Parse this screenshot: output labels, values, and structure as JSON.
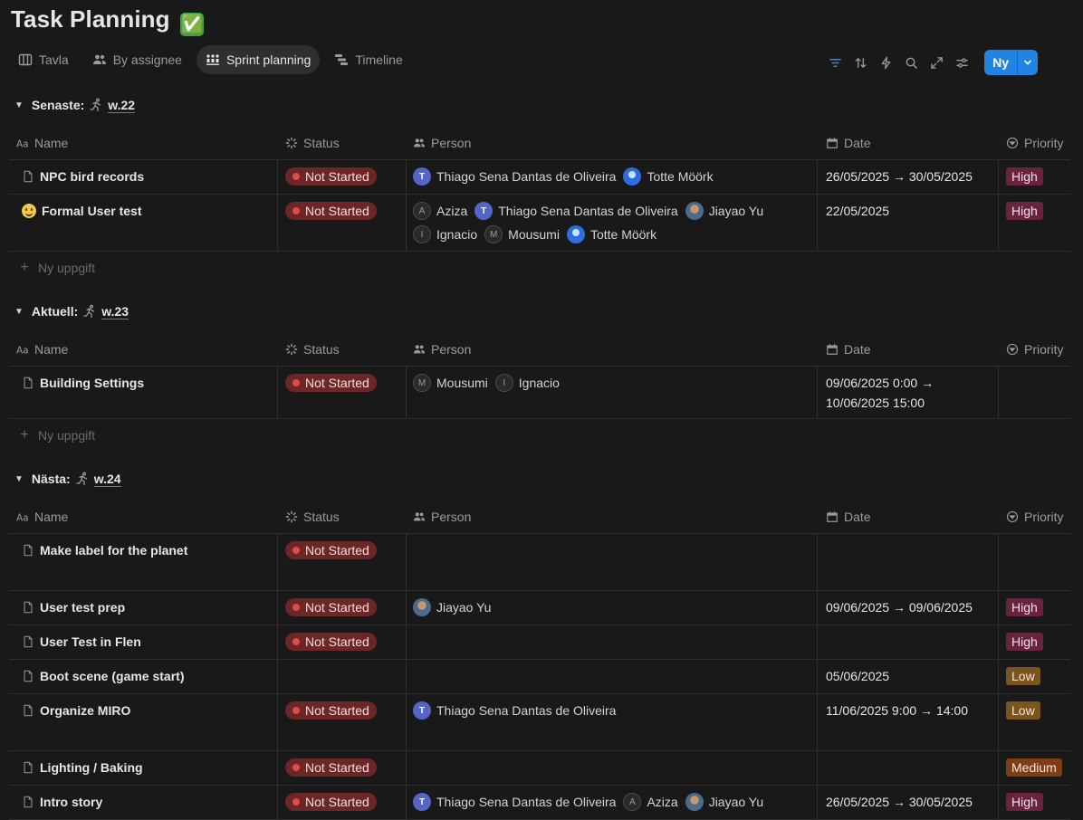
{
  "page": {
    "title": "Task Planning",
    "title_emoji": "✅"
  },
  "views": [
    {
      "label": "Tavla",
      "icon": "board-icon"
    },
    {
      "label": "By assignee",
      "icon": "people-icon"
    },
    {
      "label": "Sprint planning",
      "icon": "sprint-icon",
      "active": true
    },
    {
      "label": "Timeline",
      "icon": "timeline-icon"
    }
  ],
  "toolbar": {
    "icons": [
      "filter-icon",
      "sort-icon",
      "lightning-icon",
      "search-icon",
      "expand-icon",
      "settings-icon"
    ],
    "new_label": "Ny"
  },
  "columns": {
    "name": "Name",
    "status": "Status",
    "person": "Person",
    "date": "Date",
    "priority": "Priority"
  },
  "add_task_label": "Ny uppgift",
  "colors": {
    "accent": "#2383e2",
    "not_started_bg": "#6d2626",
    "high_bg": "#6b2240",
    "low_bg": "#7a5520",
    "medium_bg": "#7e3d16"
  },
  "groups": [
    {
      "label": "Senaste:",
      "week": "w.22",
      "rows": [
        {
          "name": "NPC bird records",
          "icon": "page",
          "status": "Not Started",
          "people": [
            {
              "name": "Thiago Sena Dantas de Oliveira",
              "avatar": "T",
              "kind": "t"
            },
            {
              "name": "Totte Möörk",
              "avatar": "",
              "kind": "totte"
            }
          ],
          "date": "26/05/2025 → 30/05/2025",
          "priority": "High"
        },
        {
          "name": "Formal User test",
          "icon": "emoji",
          "status": "Not Started",
          "people": [
            {
              "name": "Aziza",
              "avatar": "A",
              "kind": "l"
            },
            {
              "name": "Thiago Sena Dantas de Oliveira",
              "avatar": "T",
              "kind": "t"
            },
            {
              "name": "Jiayao Yu",
              "avatar": "",
              "kind": "jiayao"
            },
            {
              "name": "Ignacio",
              "avatar": "I",
              "kind": "l"
            },
            {
              "name": "Mousumi",
              "avatar": "M",
              "kind": "l"
            },
            {
              "name": "Totte Möörk",
              "avatar": "",
              "kind": "totte"
            }
          ],
          "date": "22/05/2025",
          "priority": "High"
        }
      ]
    },
    {
      "label": "Aktuell:",
      "week": "w.23",
      "rows": [
        {
          "name": "Building Settings",
          "icon": "page",
          "status": "Not Started",
          "people": [
            {
              "name": "Mousumi",
              "avatar": "M",
              "kind": "l"
            },
            {
              "name": "Ignacio",
              "avatar": "I",
              "kind": "l"
            }
          ],
          "date": "09/06/2025 0:00 →",
          "date2": "10/06/2025 15:00",
          "priority": ""
        }
      ]
    },
    {
      "label": "Nästa:",
      "week": "w.24",
      "rows": [
        {
          "name": "Make label for the planet",
          "icon": "page",
          "status": "Not Started",
          "people": [],
          "date": "",
          "priority": ""
        },
        {
          "name": "User test prep",
          "icon": "page",
          "status": "Not Started",
          "people": [
            {
              "name": "Jiayao Yu",
              "avatar": "",
              "kind": "jiayao"
            }
          ],
          "date": "09/06/2025 → 09/06/2025",
          "priority": "High"
        },
        {
          "name": "User Test in Flen",
          "icon": "page",
          "status": "Not Started",
          "people": [],
          "date": "",
          "priority": "High"
        },
        {
          "name": "Boot scene (game start)",
          "icon": "page",
          "status": "",
          "people": [],
          "date": "05/06/2025",
          "priority": "Low"
        },
        {
          "name": "Organize MIRO",
          "icon": "page",
          "status": "Not Started",
          "people": [
            {
              "name": "Thiago Sena Dantas de Oliveira",
              "avatar": "T",
              "kind": "t"
            }
          ],
          "date": "11/06/2025 9:00 → 14:00",
          "priority": "Low"
        },
        {
          "name": "Lighting / Baking",
          "icon": "page",
          "status": "Not Started",
          "people": [],
          "date": "",
          "priority": "Medium"
        },
        {
          "name": "Intro story",
          "icon": "page",
          "status": "Not Started",
          "people": [
            {
              "name": "Thiago Sena Dantas de Oliveira",
              "avatar": "T",
              "kind": "t"
            },
            {
              "name": "Aziza",
              "avatar": "A",
              "kind": "l"
            },
            {
              "name": "Jiayao Yu",
              "avatar": "",
              "kind": "jiayao"
            }
          ],
          "date": "26/05/2025 → 30/05/2025",
          "priority": "High"
        }
      ]
    }
  ]
}
